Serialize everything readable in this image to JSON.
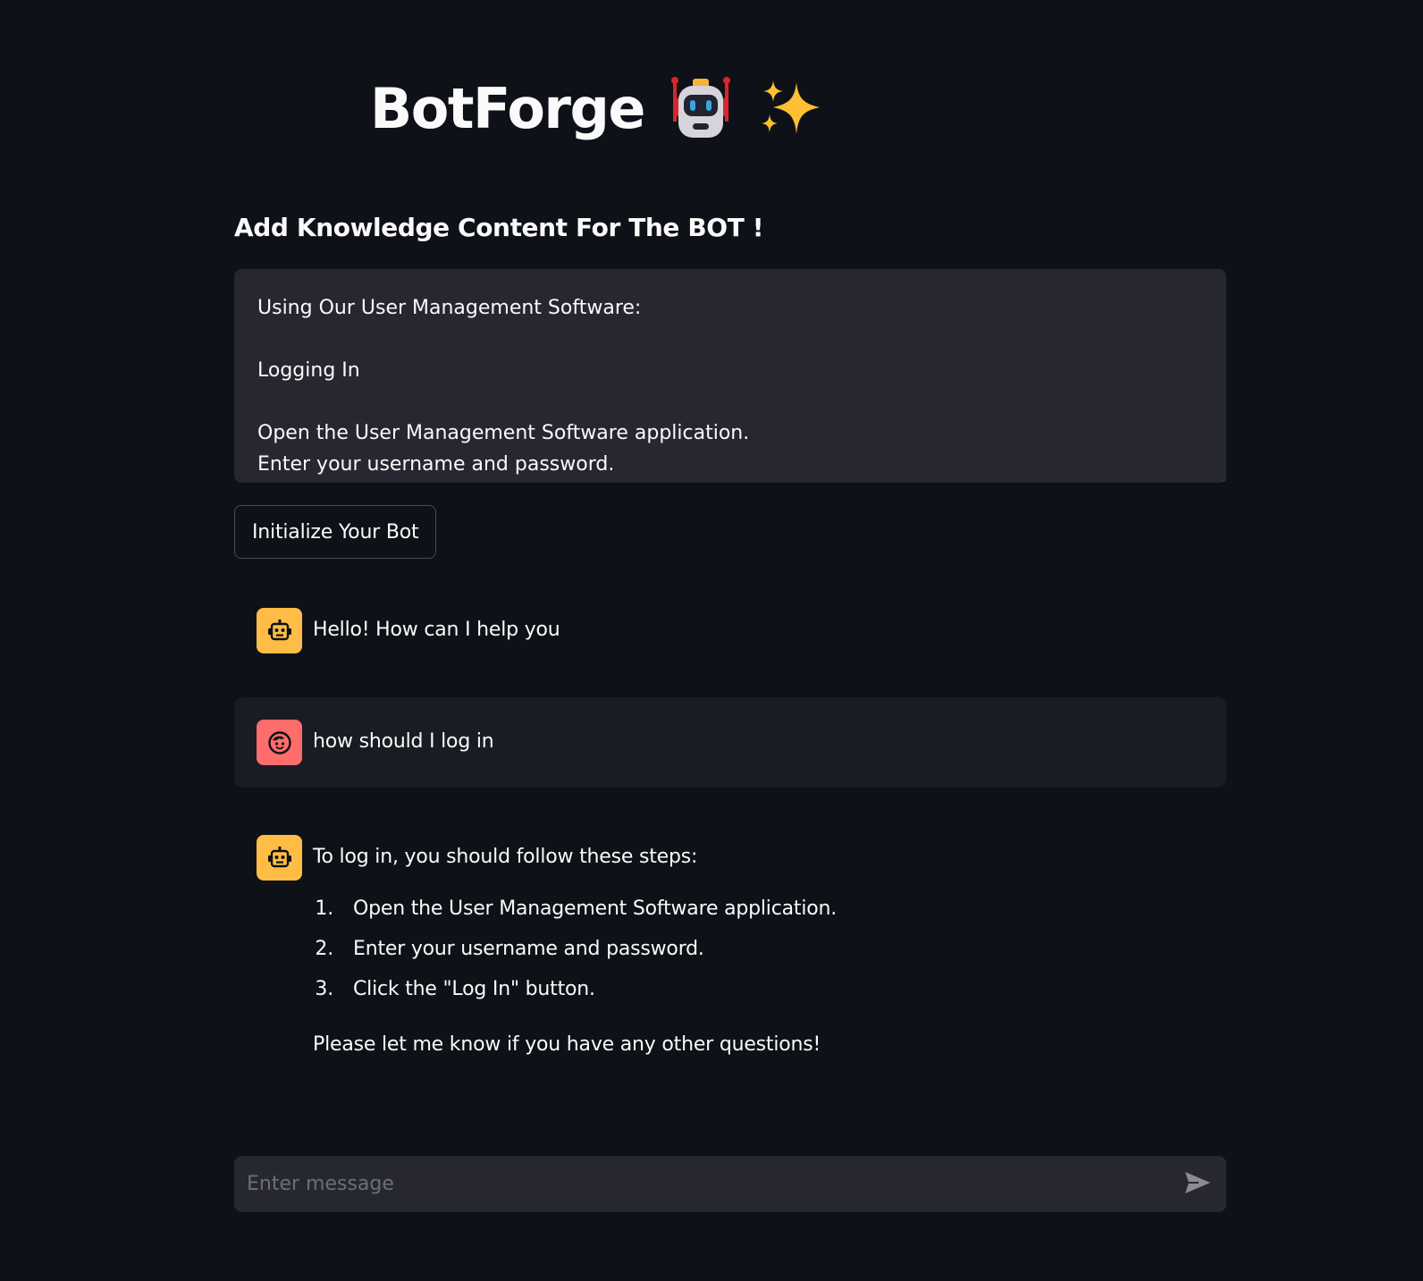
{
  "app": {
    "title": "BotForge",
    "title_emojis": [
      "robot-icon",
      "sparkles-icon"
    ]
  },
  "knowledge": {
    "heading": "Add Knowledge Content For The BOT !",
    "lines": [
      "Using Our User Management Software:",
      "",
      "Logging In",
      "",
      "Open the User Management Software application.",
      "Enter your username and password."
    ]
  },
  "initialize_button": {
    "label": "Initialize Your Bot"
  },
  "messages": [
    {
      "role": "assistant",
      "avatar": "bot-face-icon",
      "text": "Hello! How can I help you"
    },
    {
      "role": "user",
      "avatar": "user-face-icon",
      "text": "how should I log in"
    },
    {
      "role": "assistant",
      "avatar": "bot-face-icon",
      "text": "To log in, you should follow these steps:",
      "steps": [
        {
          "num": "1.",
          "text": "Open the User Management Software application."
        },
        {
          "num": "2.",
          "text": "Enter your username and password."
        },
        {
          "num": "3.",
          "text": "Click the \"Log In\" button."
        }
      ],
      "closing": "Please let me know if you have any other questions!"
    }
  ],
  "chat_input": {
    "placeholder": "Enter message",
    "value": ""
  },
  "colors": {
    "background": "#0e1117",
    "surface": "#262730",
    "user_message_bg": "#1a1c24",
    "bot_avatar": "#ffbd45",
    "user_avatar": "#ff6c6c",
    "text": "#fafafa"
  }
}
